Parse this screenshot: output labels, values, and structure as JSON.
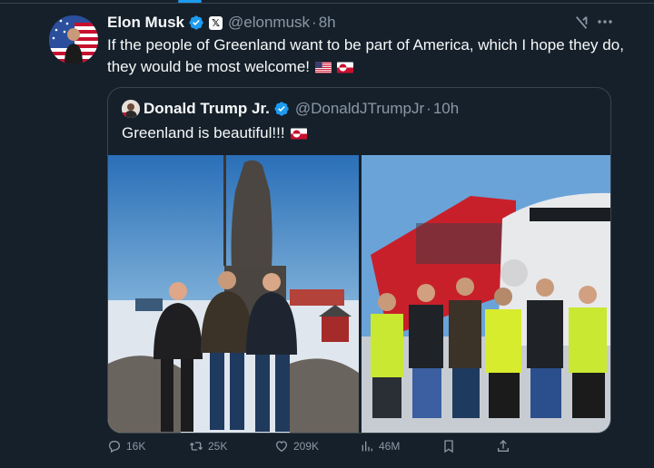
{
  "colors": {
    "background": "#15202b",
    "accent": "#1d9bf0",
    "text": "#f7f9f9",
    "muted": "#8b98a5",
    "border": "#38444d"
  },
  "tweet": {
    "author_name": "Elon Musk",
    "author_handle": "@elonmusk",
    "separator": "·",
    "time": "8h",
    "text": "If the people of Greenland want to be part of America, which I hope they do, they would be most welcome!"
  },
  "quote": {
    "author_name": "Donald Trump Jr.",
    "author_handle": "@DonaldJTrumpJr",
    "separator": "·",
    "time": "10h",
    "text": "Greenland is beautiful!!!"
  },
  "actions": {
    "replies": "16K",
    "reposts": "25K",
    "likes": "209K",
    "views": "46M"
  },
  "icons": [
    "verified-badge-icon",
    "x-premium-icon",
    "grok-icon",
    "more-icon",
    "reply-icon",
    "repost-icon",
    "like-icon",
    "views-icon",
    "bookmark-icon",
    "share-icon",
    "us-flag-icon",
    "greenland-flag-icon"
  ]
}
